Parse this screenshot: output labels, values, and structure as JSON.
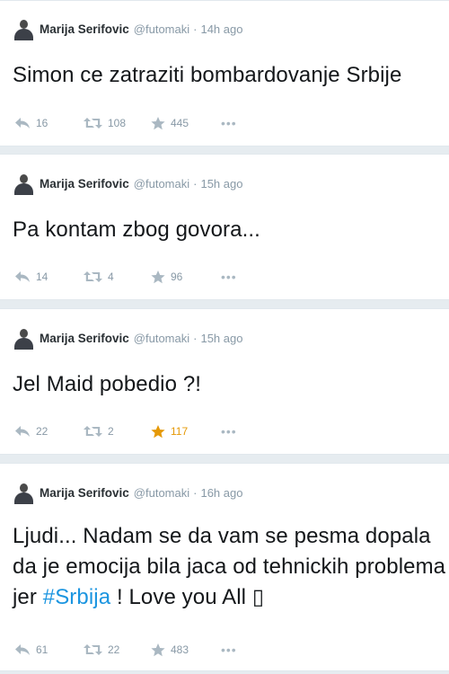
{
  "tweets": [
    {
      "name": "Marija Serifovic",
      "handle": "@futomaki",
      "sep": "·",
      "time": "14h ago",
      "lines": [
        "Simon ce zatraziti bombardovanje Srbije"
      ],
      "replies": "16",
      "retweets": "108",
      "favorites": "445",
      "favorited": false,
      "more": "•••"
    },
    {
      "name": "Marija Serifovic",
      "handle": "@futomaki",
      "sep": "·",
      "time": "15h ago",
      "lines": [
        "Pa kontam zbog govora..."
      ],
      "replies": "14",
      "retweets": "4",
      "favorites": "96",
      "favorited": false,
      "more": "•••"
    },
    {
      "name": "Marija Serifovic",
      "handle": "@futomaki",
      "sep": "·",
      "time": "15h ago",
      "lines": [
        "Jel Maid pobedio ?!"
      ],
      "replies": "22",
      "retweets": "2",
      "favorites": "117",
      "favorited": true,
      "more": "•••"
    },
    {
      "name": "Marija Serifovic",
      "handle": "@futomaki",
      "sep": "·",
      "time": "16h ago",
      "lines": [
        "Ljudi... Nadam se da vam se pesma dopala",
        "da je emocija bila jaca od tehnickih problema",
        "jer "
      ],
      "hashtag": "#Srbija",
      "line3_rest": " ! Love you All ▯",
      "replies": "61",
      "retweets": "22",
      "favorites": "483",
      "favorited": false,
      "more": "•••"
    }
  ],
  "colors": {
    "background": "#e6ecf0",
    "card": "#ffffff",
    "text": "#14171a",
    "meta": "#8899a6",
    "hashtag": "#1b95e0",
    "favorite_active": "#e59907"
  }
}
